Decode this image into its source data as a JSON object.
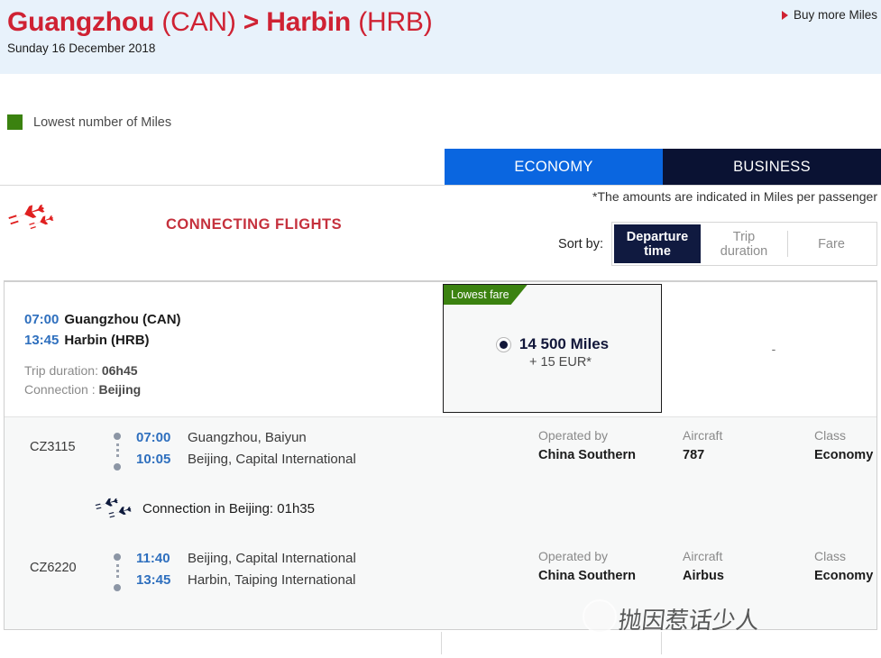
{
  "header": {
    "origin_city": "Guangzhou",
    "origin_code": "(CAN)",
    "arrow": ">",
    "destination_city": "Harbin",
    "destination_code": "(HRB)",
    "date": "Sunday 16 December 2018",
    "buy_more_miles": "Buy more Miles"
  },
  "legend": {
    "label": "Lowest number of Miles",
    "color": "#3b8210"
  },
  "cabin_tabs": [
    {
      "label": "ECONOMY",
      "active": true,
      "color": "#0a66e0"
    },
    {
      "label": "BUSINESS",
      "active": false,
      "color": "#0a1233"
    }
  ],
  "section": {
    "title": "CONNECTING FLIGHTS",
    "amount_note": "*The amounts are indicated in Miles per passenger",
    "sort_label": "Sort by:",
    "sort_options": [
      {
        "label": "Departure time",
        "line1": "Departure",
        "line2": "time",
        "active": true
      },
      {
        "label": "Trip duration",
        "line1": "Trip",
        "line2": "duration",
        "active": false
      },
      {
        "label": "Fare",
        "line1": "Fare",
        "line2": "",
        "active": false
      }
    ]
  },
  "itinerary": {
    "depart_time": "07:00",
    "depart_city": "Guangzhou (CAN)",
    "arrive_time": "13:45",
    "arrive_city": "Harbin (HRB)",
    "trip_duration_label": "Trip duration:",
    "trip_duration_value": "06h45",
    "connection_label": "Connection :",
    "connection_value": "Beijing"
  },
  "fare": {
    "ribbon": "Lowest fare",
    "miles": "14 500 Miles",
    "surcharge": "+ 15 EUR*",
    "selected": true,
    "business_value": "-"
  },
  "segments": [
    {
      "flight_number": "CZ3115",
      "depart_time": "07:00",
      "depart_airport": "Guangzhou, Baiyun",
      "arrive_time": "10:05",
      "arrive_airport": "Beijing, Capital International",
      "operated_label": "Operated by",
      "operated_value": "China Southern",
      "aircraft_label": "Aircraft",
      "aircraft_value": "787",
      "class_label": "Class",
      "class_value": "Economy"
    },
    {
      "flight_number": "CZ6220",
      "depart_time": "11:40",
      "depart_airport": "Beijing, Capital International",
      "arrive_time": "13:45",
      "arrive_airport": "Harbin, Taiping International",
      "operated_label": "Operated by",
      "operated_value": "China Southern",
      "aircraft_label": "Aircraft",
      "aircraft_value": "Airbus",
      "class_label": "Class",
      "class_value": "Economy"
    }
  ],
  "connection": {
    "text": "Connection in Beijing: 01h35"
  },
  "watermark": {
    "text": "抛因惹话少人"
  }
}
